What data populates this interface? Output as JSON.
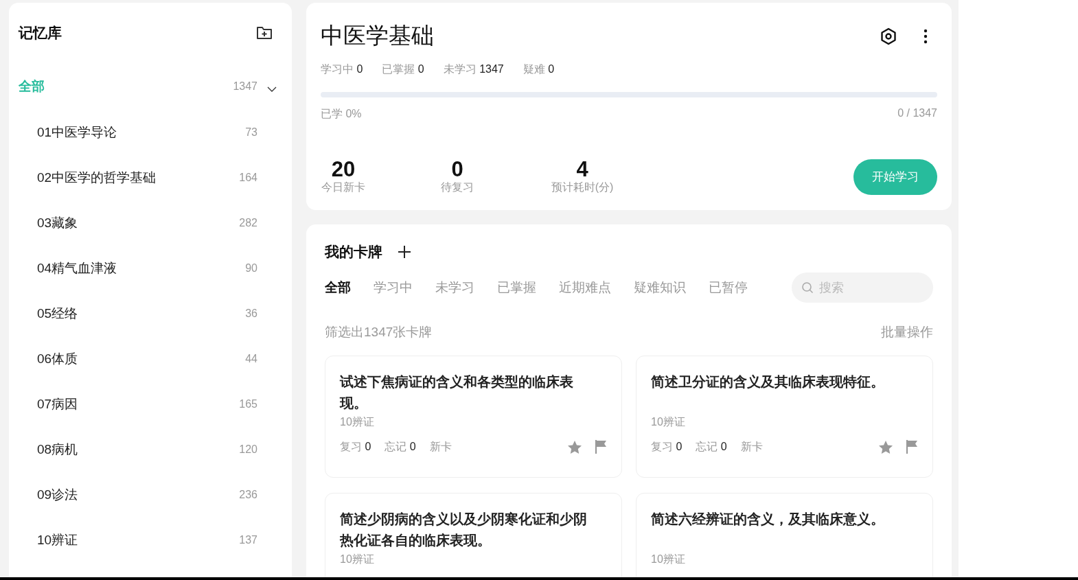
{
  "sidebar": {
    "title": "记忆库",
    "items": [
      {
        "name": "全部",
        "count": "1347",
        "selected": true,
        "expanded": true,
        "children": [
          {
            "name": "01中医学导论",
            "count": "73",
            "selected": false
          },
          {
            "name": "02中医学的哲学基础",
            "count": "164",
            "selected": false
          },
          {
            "name": "03藏象",
            "count": "282",
            "selected": false
          },
          {
            "name": "04精气血津液",
            "count": "90",
            "selected": false
          },
          {
            "name": "05经络",
            "count": "36",
            "selected": false
          },
          {
            "name": "06体质",
            "count": "44",
            "selected": false
          },
          {
            "name": "07病因",
            "count": "165",
            "selected": false
          },
          {
            "name": "08病机",
            "count": "120",
            "selected": false
          },
          {
            "name": "09诊法",
            "count": "236",
            "selected": false
          },
          {
            "name": "10辨证",
            "count": "137",
            "selected": false
          }
        ]
      }
    ]
  },
  "deck": {
    "title": "中医学基础",
    "stats": [
      {
        "label": "学习中",
        "value": "0"
      },
      {
        "label": "已掌握",
        "value": "0"
      },
      {
        "label": "未学习",
        "value": "1347"
      },
      {
        "label": "疑难",
        "value": "0"
      }
    ],
    "progress": {
      "level": 0,
      "label": "已学 0%",
      "reading": "0 / 1347"
    },
    "summary": [
      {
        "value": "20",
        "label": "今日新卡"
      },
      {
        "value": "0",
        "label": "待复习"
      },
      {
        "value": "4",
        "label": "预计耗时(分)"
      }
    ],
    "start_button": "开始学习"
  },
  "cards_panel": {
    "title": "我的卡牌",
    "tabs": [
      {
        "label": "全部",
        "selected": true
      },
      {
        "label": "学习中",
        "selected": false
      },
      {
        "label": "未学习",
        "selected": false
      },
      {
        "label": "已掌握",
        "selected": false
      },
      {
        "label": "近期难点",
        "selected": false
      },
      {
        "label": "疑难知识",
        "selected": false
      },
      {
        "label": "已暂停",
        "selected": false
      }
    ],
    "search": {
      "placeholder": "搜索"
    },
    "filter_text": "筛选出1347张卡牌",
    "batch_button": "批量操作",
    "cards": [
      {
        "question": "试述下焦病证的含义和各类型的临床表现。",
        "deck": "10辨证",
        "stats": [
          {
            "label": "复习",
            "value": "0"
          },
          {
            "label": "忘记",
            "value": "0"
          },
          {
            "label": "新卡"
          }
        ]
      },
      {
        "question": "简述卫分证的含义及其临床表现特征。",
        "deck": "10辨证",
        "stats": [
          {
            "label": "复习",
            "value": "0"
          },
          {
            "label": "忘记",
            "value": "0"
          },
          {
            "label": "新卡"
          }
        ]
      },
      {
        "question": "简述少阴病的含义以及少阴寒化证和少阴热化证各自的临床表现。",
        "deck": "10辨证"
      },
      {
        "question": "简述六经辨证的含义，及其临床意义。",
        "deck": "10辨证"
      }
    ]
  }
}
